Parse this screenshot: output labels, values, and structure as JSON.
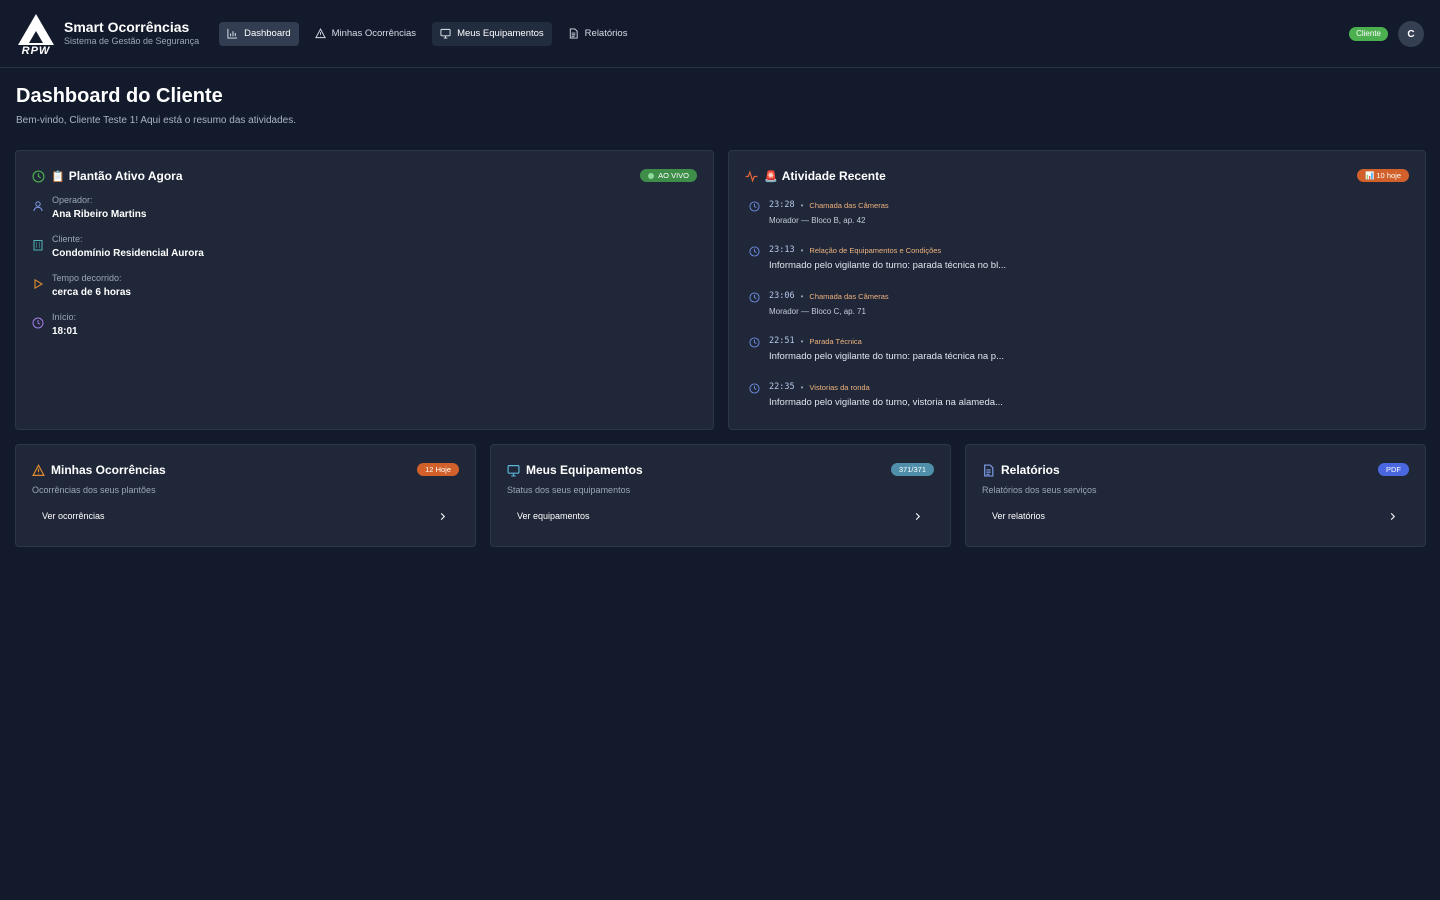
{
  "brand": {
    "title": "Smart Ocorrências",
    "subtitle": "Sistema de Gestão de Segurança",
    "logo_text": "RPW"
  },
  "nav": [
    {
      "label": "Dashboard",
      "icon": "bar-chart-icon"
    },
    {
      "label": "Minhas Ocorrências",
      "icon": "warning-icon"
    },
    {
      "label": "Meus Equipamentos",
      "icon": "monitor-icon"
    },
    {
      "label": "Relatórios",
      "icon": "document-icon"
    }
  ],
  "user": {
    "role": "Cliente",
    "initial": "C"
  },
  "page": {
    "title": "Dashboard do Cliente",
    "subtitle": "Bem-vindo, Cliente Teste 1! Aqui está o resumo das atividades."
  },
  "plantao": {
    "emoji": "📋",
    "title": "Plantão Ativo Agora",
    "badge": "AO VIVO",
    "rows": [
      {
        "label": "Operador:",
        "value": "Ana Ribeiro Martins",
        "icon": "user-icon"
      },
      {
        "label": "Cliente:",
        "value": "Condomínio Residencial Aurora",
        "icon": "building-icon"
      },
      {
        "label": "Tempo decorrido:",
        "value": "cerca de 6 horas",
        "icon": "play-icon"
      },
      {
        "label": "Início:",
        "value": "18:01",
        "icon": "clock-icon"
      }
    ]
  },
  "atividade": {
    "emoji": "🚨",
    "title": "Atividade Recente",
    "badge": "📊 10 hoje",
    "items": [
      {
        "time": "23:28",
        "category": "Chamada das Câmeras",
        "description": "Morador — Bloco B, ap. 42"
      },
      {
        "time": "23:13",
        "category": "Relação de Equipamentos e Condições",
        "description": "Informado pelo vigilante do turno: parada técnica no bl..."
      },
      {
        "time": "23:06",
        "category": "Chamada das Câmeras",
        "description": "Morador — Bloco C, ap. 71"
      },
      {
        "time": "22:51",
        "category": "Parada Técnica",
        "description": "Informado pelo vigilante do turno: parada técnica na p..."
      },
      {
        "time": "22:35",
        "category": "Vistorias da ronda",
        "description": "Informado pelo vigilante do turno, vistoria na alameda..."
      }
    ]
  },
  "cards": [
    {
      "title": "Minhas Ocorrências",
      "subtitle": "Ocorrências dos seus plantões",
      "badge": "12 Hoje",
      "link": "Ver ocorrências",
      "badge_color": "#d2602a"
    },
    {
      "title": "Meus Equipamentos",
      "subtitle": "Status dos seus equipamentos",
      "badge": "371/371",
      "link": "Ver equipamentos",
      "badge_color": "#4f8fa9"
    },
    {
      "title": "Relatórios",
      "subtitle": "Relatórios dos seus serviços",
      "badge": "PDF",
      "link": "Ver relatórios",
      "badge_color": "#4a67e0"
    }
  ],
  "colors": {
    "background": "#131a2b",
    "card": "#1f2738",
    "accent_green": "#4caf50",
    "accent_orange": "#d2602a"
  }
}
